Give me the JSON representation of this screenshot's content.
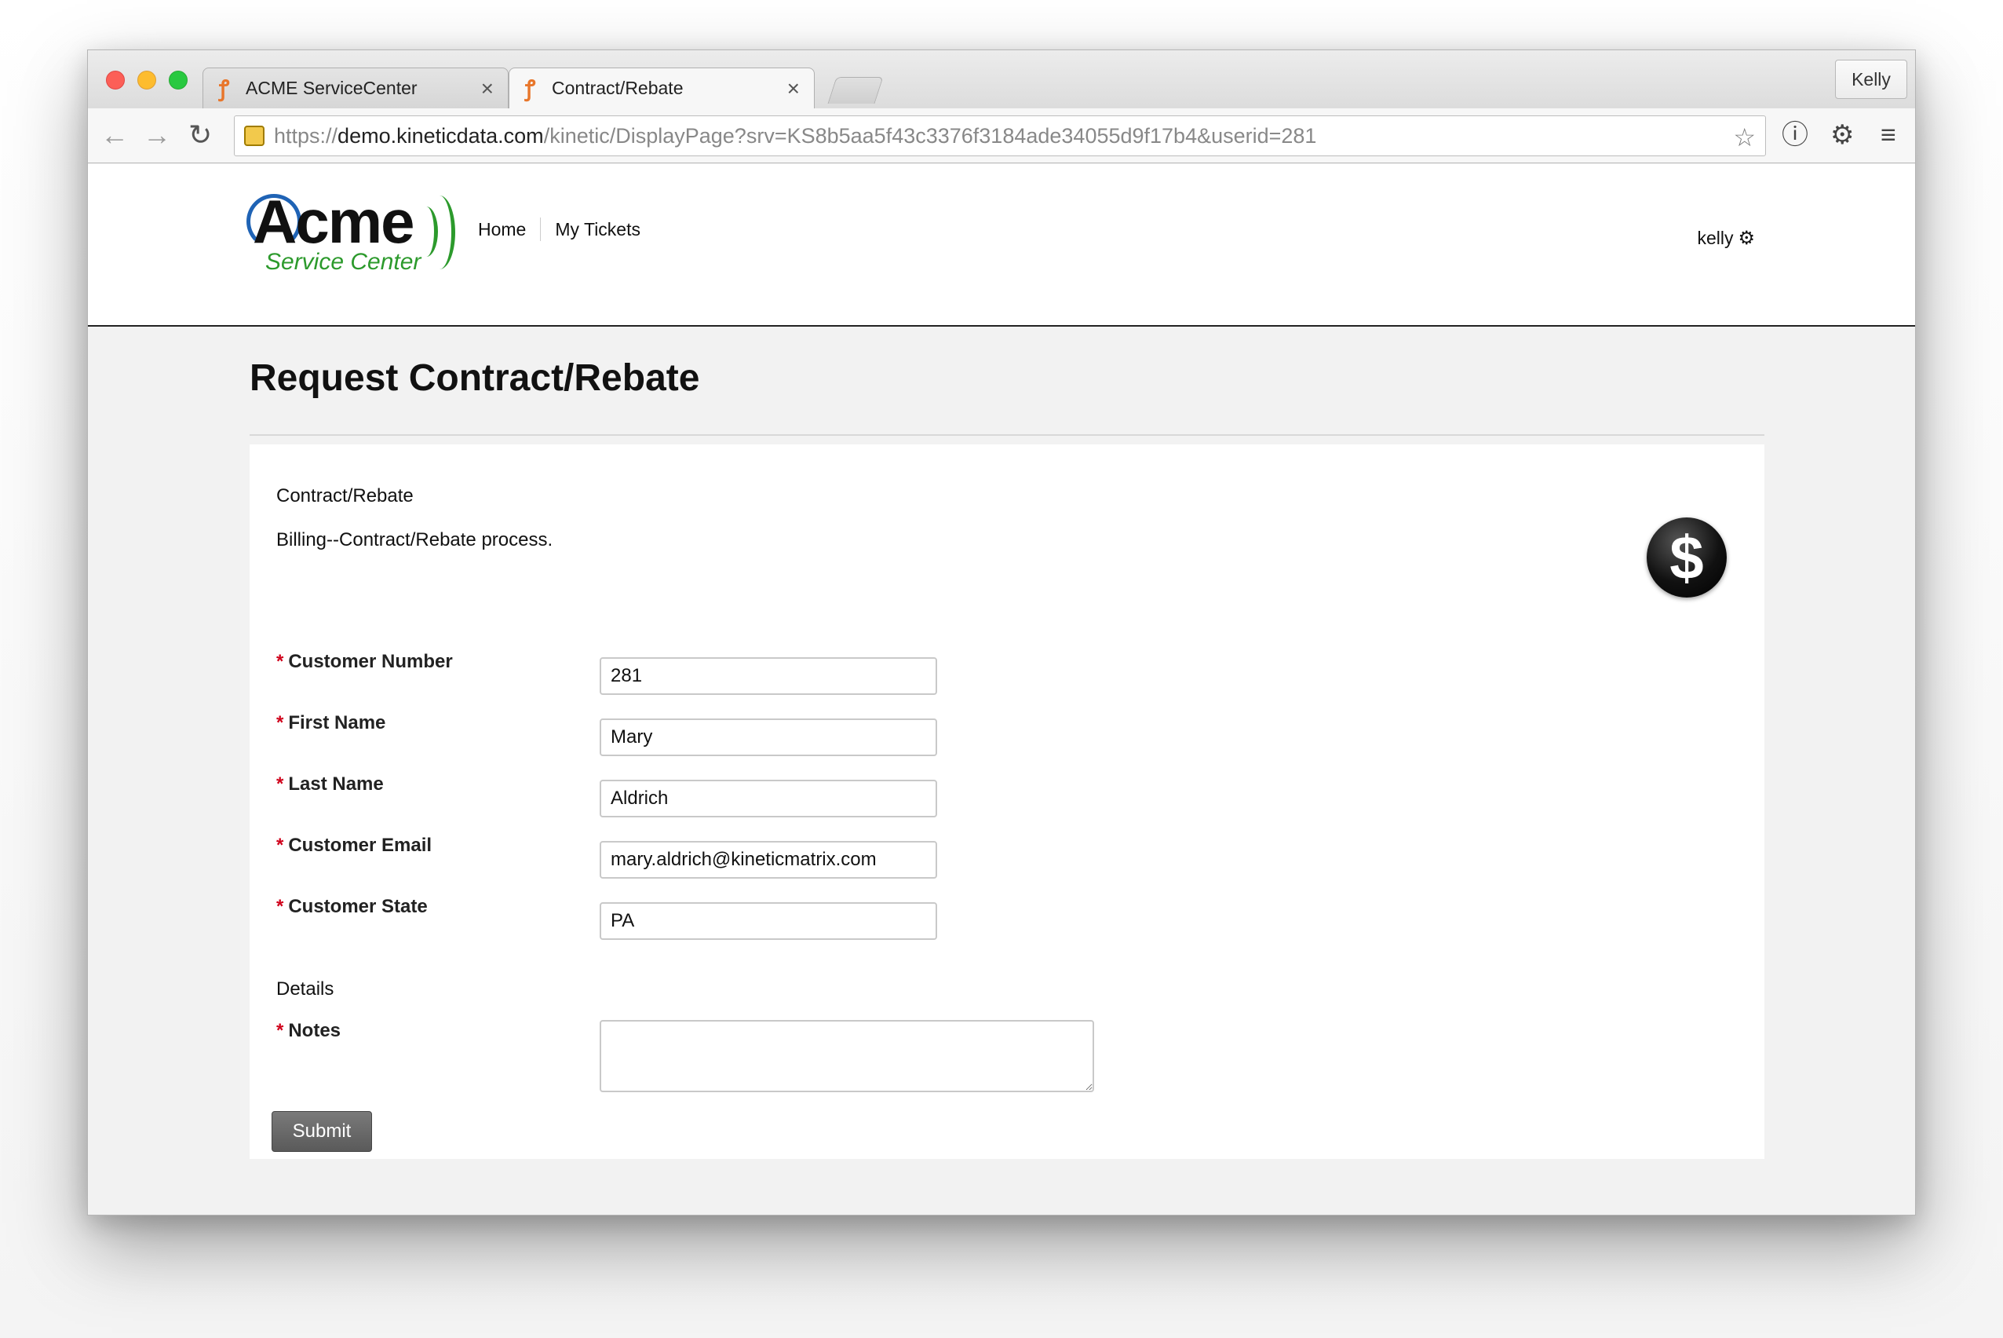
{
  "browser": {
    "tabs": [
      {
        "title": "ACME ServiceCenter",
        "active": false
      },
      {
        "title": "Contract/Rebate",
        "active": true
      }
    ],
    "profile_name": "Kelly",
    "url": {
      "scheme": "https://",
      "host": "demo.kineticdata.com",
      "path": "/kinetic/DisplayPage?srv=KS8b5aa5f43c3376f3184ade34055d9f17b4&userid=281"
    },
    "icons": {
      "back": "back-arrow-icon",
      "forward": "forward-arrow-icon",
      "reload": "reload-icon",
      "bookmark": "star-icon",
      "extension": "info-circle-icon",
      "settings": "gear-icon",
      "menu": "hamburger-menu-icon"
    }
  },
  "site": {
    "logo": {
      "main": "Acme",
      "sub": "Service Center"
    },
    "nav": [
      {
        "label": "Home"
      },
      {
        "label": "My Tickets"
      }
    ],
    "user": "kelly"
  },
  "page": {
    "title": "Request Contract/Rebate",
    "service_name": "Contract/Rebate",
    "service_description": "Billing--Contract/Rebate process.",
    "fields": [
      {
        "label": "Customer Number",
        "value": "281",
        "required": true
      },
      {
        "label": "First Name",
        "value": "Mary",
        "required": true
      },
      {
        "label": "Last Name",
        "value": "Aldrich",
        "required": true
      },
      {
        "label": "Customer Email",
        "value": "mary.aldrich@kineticmatrix.com",
        "required": true
      },
      {
        "label": "Customer State",
        "value": "PA",
        "required": true
      }
    ],
    "details_section": "Details",
    "notes": {
      "label": "Notes",
      "value": "",
      "required": true
    },
    "required_marker": "*",
    "submit_label": "Submit"
  },
  "colors": {
    "required": "#d0011b",
    "logo_blue": "#1f63b5",
    "logo_green": "#2c9a2c",
    "tab_favicon": "#e8762b"
  }
}
